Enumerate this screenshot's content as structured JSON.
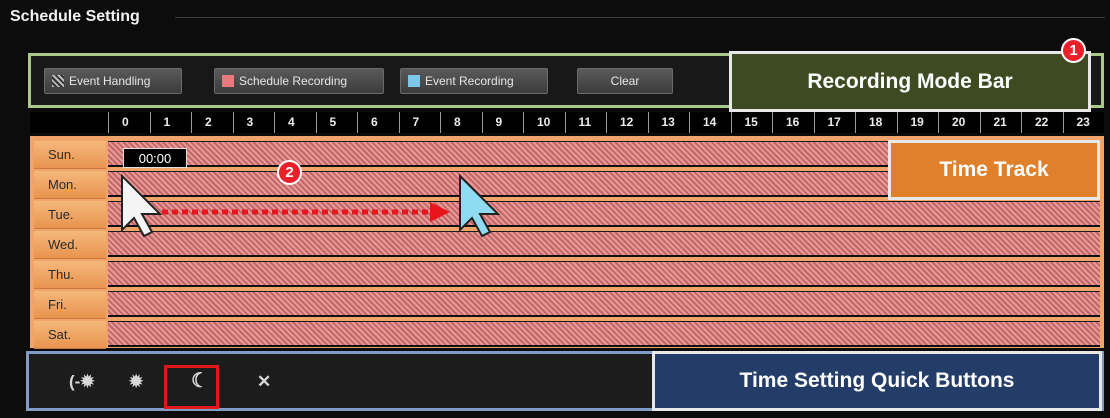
{
  "header": {
    "title": "Schedule Setting"
  },
  "mode_bar": {
    "buttons": [
      {
        "label": "Event Handling",
        "icon": "hatched-swatch-icon"
      },
      {
        "label": "Schedule Recording",
        "icon": "red-swatch-icon",
        "color": "#e8797f"
      },
      {
        "label": "Event Recording",
        "icon": "blue-swatch-icon",
        "color": "#7cc7e8"
      },
      {
        "label": "Clear"
      }
    ]
  },
  "callouts": {
    "recording_mode_bar": {
      "label": "Recording Mode Bar",
      "badge": "1",
      "color": "#3e4b22"
    },
    "time_track": {
      "label": "Time Track",
      "color": "#e0802b"
    },
    "time_setting_quick_buttons": {
      "label": "Time Setting Quick Buttons",
      "color": "#243c68"
    },
    "drag_step_badge": "2"
  },
  "ruler": {
    "hours": [
      "0",
      "1",
      "2",
      "3",
      "4",
      "5",
      "6",
      "7",
      "8",
      "9",
      "10",
      "11",
      "12",
      "13",
      "14",
      "15",
      "16",
      "17",
      "18",
      "19",
      "20",
      "21",
      "22",
      "23"
    ]
  },
  "days": [
    "Sun.",
    "Mon.",
    "Tue.",
    "Wed.",
    "Thu.",
    "Fri.",
    "Sat."
  ],
  "time_tooltip": "00:00",
  "quick_buttons": [
    {
      "glyph": "(-✹",
      "icon": "night-day-icon"
    },
    {
      "glyph": "✹",
      "icon": "day-icon"
    },
    {
      "glyph": "☾",
      "icon": "night-icon",
      "highlighted": true
    },
    {
      "glyph": "✕",
      "icon": "clear-icon"
    }
  ]
}
